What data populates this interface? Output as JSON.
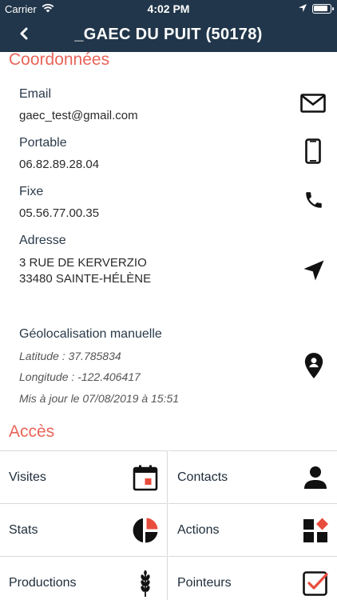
{
  "status_bar": {
    "carrier": "Carrier",
    "time": "4:02 PM",
    "battery_level": 0.92
  },
  "nav": {
    "title": "_GAEC DU PUIT (50178)"
  },
  "coordonnees": {
    "section_title": "Coordonnées",
    "email": {
      "label": "Email",
      "value": "gaec_test@gmail.com",
      "icon": "envelope-icon"
    },
    "portable": {
      "label": "Portable",
      "value": "06.82.89.28.04",
      "icon": "mobile-phone-icon"
    },
    "fixe": {
      "label": "Fixe",
      "value": "05.56.77.00.35",
      "icon": "phone-icon"
    },
    "adresse": {
      "label": "Adresse",
      "line1": "3 RUE DE KERVERZIO",
      "line2": "33480 SAINTE-HÉLÈNE",
      "icon": "navigation-arrow-icon"
    },
    "geoloc": {
      "label": "Géolocalisation manuelle",
      "latitude": "Latitude  : 37.785834",
      "longitude": "Longitude : -122.406417",
      "updated": "Mis à jour le 07/08/2019 à 15:51",
      "icon": "location-pin-icon"
    }
  },
  "acces": {
    "section_title": "Accès",
    "items": [
      {
        "label": "Visites",
        "icon": "calendar-icon"
      },
      {
        "label": "Contacts",
        "icon": "person-icon"
      },
      {
        "label": "Stats",
        "icon": "pie-chart-icon"
      },
      {
        "label": "Actions",
        "icon": "shapes-icon"
      },
      {
        "label": "Productions",
        "icon": "wheat-icon"
      },
      {
        "label": "Pointeurs",
        "icon": "checkbox-icon"
      }
    ]
  },
  "colors": {
    "navbar": "#21364a",
    "section_title": "#e8655a",
    "accent_red": "#e84c3d"
  }
}
